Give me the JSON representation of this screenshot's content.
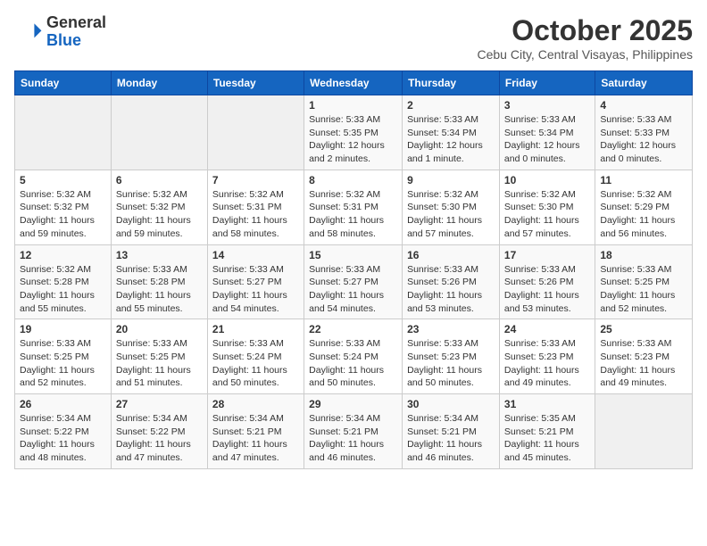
{
  "header": {
    "logo_general": "General",
    "logo_blue": "Blue",
    "month": "October 2025",
    "location": "Cebu City, Central Visayas, Philippines"
  },
  "days_of_week": [
    "Sunday",
    "Monday",
    "Tuesday",
    "Wednesday",
    "Thursday",
    "Friday",
    "Saturday"
  ],
  "weeks": [
    [
      {
        "day": "",
        "info": ""
      },
      {
        "day": "",
        "info": ""
      },
      {
        "day": "",
        "info": ""
      },
      {
        "day": "1",
        "info": "Sunrise: 5:33 AM\nSunset: 5:35 PM\nDaylight: 12 hours\nand 2 minutes."
      },
      {
        "day": "2",
        "info": "Sunrise: 5:33 AM\nSunset: 5:34 PM\nDaylight: 12 hours\nand 1 minute."
      },
      {
        "day": "3",
        "info": "Sunrise: 5:33 AM\nSunset: 5:34 PM\nDaylight: 12 hours\nand 0 minutes."
      },
      {
        "day": "4",
        "info": "Sunrise: 5:33 AM\nSunset: 5:33 PM\nDaylight: 12 hours\nand 0 minutes."
      }
    ],
    [
      {
        "day": "5",
        "info": "Sunrise: 5:32 AM\nSunset: 5:32 PM\nDaylight: 11 hours\nand 59 minutes."
      },
      {
        "day": "6",
        "info": "Sunrise: 5:32 AM\nSunset: 5:32 PM\nDaylight: 11 hours\nand 59 minutes."
      },
      {
        "day": "7",
        "info": "Sunrise: 5:32 AM\nSunset: 5:31 PM\nDaylight: 11 hours\nand 58 minutes."
      },
      {
        "day": "8",
        "info": "Sunrise: 5:32 AM\nSunset: 5:31 PM\nDaylight: 11 hours\nand 58 minutes."
      },
      {
        "day": "9",
        "info": "Sunrise: 5:32 AM\nSunset: 5:30 PM\nDaylight: 11 hours\nand 57 minutes."
      },
      {
        "day": "10",
        "info": "Sunrise: 5:32 AM\nSunset: 5:30 PM\nDaylight: 11 hours\nand 57 minutes."
      },
      {
        "day": "11",
        "info": "Sunrise: 5:32 AM\nSunset: 5:29 PM\nDaylight: 11 hours\nand 56 minutes."
      }
    ],
    [
      {
        "day": "12",
        "info": "Sunrise: 5:32 AM\nSunset: 5:28 PM\nDaylight: 11 hours\nand 55 minutes."
      },
      {
        "day": "13",
        "info": "Sunrise: 5:33 AM\nSunset: 5:28 PM\nDaylight: 11 hours\nand 55 minutes."
      },
      {
        "day": "14",
        "info": "Sunrise: 5:33 AM\nSunset: 5:27 PM\nDaylight: 11 hours\nand 54 minutes."
      },
      {
        "day": "15",
        "info": "Sunrise: 5:33 AM\nSunset: 5:27 PM\nDaylight: 11 hours\nand 54 minutes."
      },
      {
        "day": "16",
        "info": "Sunrise: 5:33 AM\nSunset: 5:26 PM\nDaylight: 11 hours\nand 53 minutes."
      },
      {
        "day": "17",
        "info": "Sunrise: 5:33 AM\nSunset: 5:26 PM\nDaylight: 11 hours\nand 53 minutes."
      },
      {
        "day": "18",
        "info": "Sunrise: 5:33 AM\nSunset: 5:25 PM\nDaylight: 11 hours\nand 52 minutes."
      }
    ],
    [
      {
        "day": "19",
        "info": "Sunrise: 5:33 AM\nSunset: 5:25 PM\nDaylight: 11 hours\nand 52 minutes."
      },
      {
        "day": "20",
        "info": "Sunrise: 5:33 AM\nSunset: 5:25 PM\nDaylight: 11 hours\nand 51 minutes."
      },
      {
        "day": "21",
        "info": "Sunrise: 5:33 AM\nSunset: 5:24 PM\nDaylight: 11 hours\nand 50 minutes."
      },
      {
        "day": "22",
        "info": "Sunrise: 5:33 AM\nSunset: 5:24 PM\nDaylight: 11 hours\nand 50 minutes."
      },
      {
        "day": "23",
        "info": "Sunrise: 5:33 AM\nSunset: 5:23 PM\nDaylight: 11 hours\nand 50 minutes."
      },
      {
        "day": "24",
        "info": "Sunrise: 5:33 AM\nSunset: 5:23 PM\nDaylight: 11 hours\nand 49 minutes."
      },
      {
        "day": "25",
        "info": "Sunrise: 5:33 AM\nSunset: 5:23 PM\nDaylight: 11 hours\nand 49 minutes."
      }
    ],
    [
      {
        "day": "26",
        "info": "Sunrise: 5:34 AM\nSunset: 5:22 PM\nDaylight: 11 hours\nand 48 minutes."
      },
      {
        "day": "27",
        "info": "Sunrise: 5:34 AM\nSunset: 5:22 PM\nDaylight: 11 hours\nand 47 minutes."
      },
      {
        "day": "28",
        "info": "Sunrise: 5:34 AM\nSunset: 5:21 PM\nDaylight: 11 hours\nand 47 minutes."
      },
      {
        "day": "29",
        "info": "Sunrise: 5:34 AM\nSunset: 5:21 PM\nDaylight: 11 hours\nand 46 minutes."
      },
      {
        "day": "30",
        "info": "Sunrise: 5:34 AM\nSunset: 5:21 PM\nDaylight: 11 hours\nand 46 minutes."
      },
      {
        "day": "31",
        "info": "Sunrise: 5:35 AM\nSunset: 5:21 PM\nDaylight: 11 hours\nand 45 minutes."
      },
      {
        "day": "",
        "info": ""
      }
    ]
  ]
}
